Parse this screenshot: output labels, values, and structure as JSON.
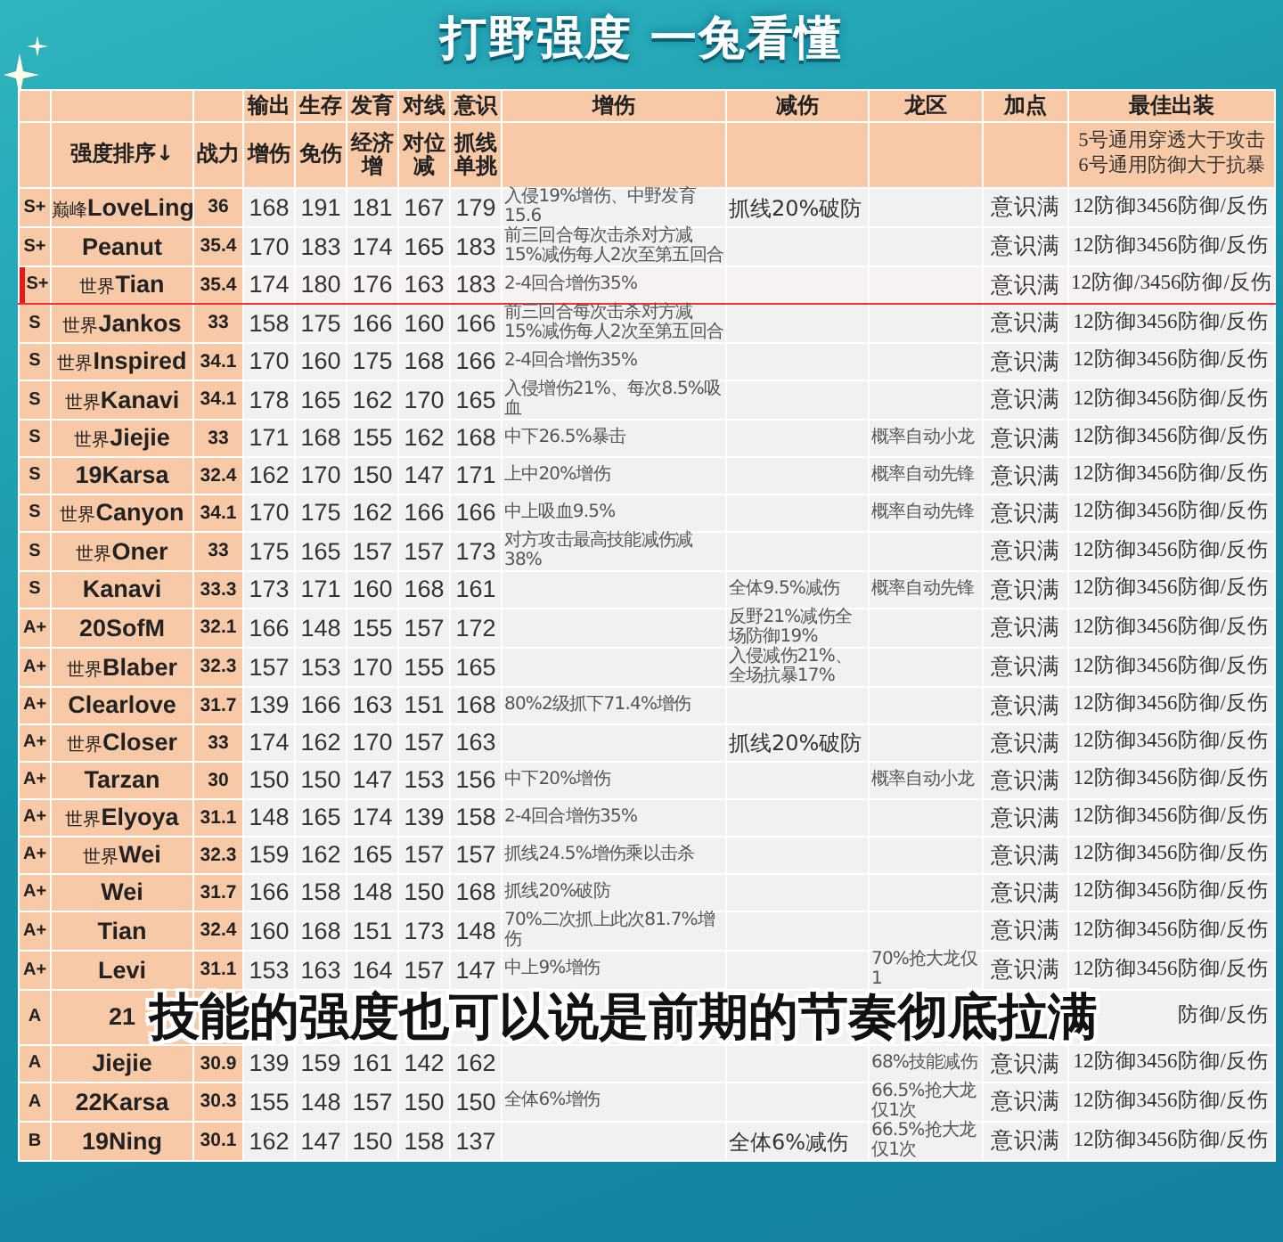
{
  "title": "打野强度 一兔看懂",
  "header_top": [
    "输出",
    "生存",
    "发育",
    "对线",
    "意识",
    "增伤",
    "减伤",
    "龙区",
    "加点",
    "最佳出装"
  ],
  "header_sub": {
    "rank": "强度排序↓",
    "power": "战力",
    "stats": [
      "增伤",
      "免伤",
      "经济增",
      "对位减",
      "抓线单挑"
    ],
    "build_note": [
      "5号通用穿透大于攻击",
      "6号通用防御大于抗暴"
    ]
  },
  "rows": [
    {
      "tier": "S+",
      "prefix": "巅峰",
      "name": "LoveLing",
      "power": "36",
      "stats": [
        "168",
        "191",
        "181",
        "167",
        "179"
      ],
      "damage": "入侵19%增伤、中野发育15.6",
      "reduction": "抓线20%破防",
      "reduction_large": true,
      "points": "意识满",
      "build": "12防御3456防御/反伤",
      "selected": false
    },
    {
      "tier": "S+",
      "name": "Peanut",
      "power": "35.4",
      "stats": [
        "170",
        "183",
        "174",
        "165",
        "183"
      ],
      "damage": "前三回合每次击杀对方减15%减伤每人2次至第五回合",
      "points": "意识满",
      "build": "12防御3456防御/反伤",
      "selected": false
    },
    {
      "tier": "S+",
      "prefix": "世界",
      "name": "Tian",
      "power": "35.4",
      "stats": [
        "174",
        "180",
        "176",
        "163",
        "183"
      ],
      "damage": "2-4回合增伤35%",
      "points": "意识满",
      "build": "12防御/3456防御/反伤",
      "selected": true
    },
    {
      "tier": "S",
      "prefix": "世界",
      "name": "Jankos",
      "power": "33",
      "stats": [
        "158",
        "175",
        "166",
        "160",
        "166"
      ],
      "damage": "前三回合每次击杀对方减15%减伤每人2次至第五回合",
      "points": "意识满",
      "build": "12防御3456防御/反伤",
      "selected": false
    },
    {
      "tier": "S",
      "prefix": "世界",
      "name": "Inspired",
      "power": "34.1",
      "stats": [
        "170",
        "160",
        "175",
        "168",
        "166"
      ],
      "damage": "2-4回合增伤35%",
      "points": "意识满",
      "build": "12防御3456防御/反伤",
      "selected": false
    },
    {
      "tier": "S",
      "prefix": "世界",
      "name": "Kanavi",
      "power": "34.1",
      "stats": [
        "178",
        "165",
        "162",
        "170",
        "165"
      ],
      "damage": "入侵增伤21%、每次8.5%吸血",
      "points": "意识满",
      "build": "12防御3456防御/反伤",
      "selected": false
    },
    {
      "tier": "S",
      "prefix": "世界",
      "name": "Jiejie",
      "power": "33",
      "stats": [
        "171",
        "168",
        "155",
        "162",
        "168"
      ],
      "damage": "中下26.5%暴击",
      "dragon": "概率自动小龙",
      "points": "意识满",
      "build": "12防御3456防御/反伤",
      "selected": false
    },
    {
      "tier": "S",
      "name": "19Karsa",
      "power": "32.4",
      "stats": [
        "162",
        "170",
        "150",
        "147",
        "171"
      ],
      "damage": "上中20%增伤",
      "dragon": "概率自动先锋",
      "points": "意识满",
      "build": "12防御3456防御/反伤",
      "selected": false
    },
    {
      "tier": "S",
      "prefix": "世界",
      "name": "Canyon",
      "power": "34.1",
      "stats": [
        "170",
        "175",
        "162",
        "166",
        "166"
      ],
      "damage": "中上吸血9.5%",
      "dragon": "概率自动先锋",
      "points": "意识满",
      "build": "12防御3456防御/反伤",
      "selected": false
    },
    {
      "tier": "S",
      "prefix": "世界",
      "name": "Oner",
      "power": "33",
      "stats": [
        "175",
        "165",
        "157",
        "157",
        "173"
      ],
      "damage": "对方攻击最高技能减伤减38%",
      "points": "意识满",
      "build": "12防御3456防御/反伤",
      "selected": false
    },
    {
      "tier": "S",
      "name": "Kanavi",
      "power": "33.3",
      "stats": [
        "173",
        "171",
        "160",
        "168",
        "161"
      ],
      "reduction": "全体9.5%减伤",
      "reduction_large": false,
      "dragon": "概率自动先锋",
      "points": "意识满",
      "build": "12防御3456防御/反伤",
      "selected": false
    },
    {
      "tier": "A+",
      "name": "20SofM",
      "power": "32.1",
      "stats": [
        "166",
        "148",
        "155",
        "157",
        "172"
      ],
      "reduction": "反野21%减伤全场防御19%",
      "reduction_large": false,
      "points": "意识满",
      "build": "12防御3456防御/反伤",
      "selected": false
    },
    {
      "tier": "A+",
      "prefix": "世界",
      "name": "Blaber",
      "power": "32.3",
      "stats": [
        "157",
        "153",
        "170",
        "155",
        "165"
      ],
      "reduction": "入侵减伤21%、全场抗暴17%",
      "reduction_large": false,
      "points": "意识满",
      "build": "12防御3456防御/反伤",
      "selected": false
    },
    {
      "tier": "A+",
      "name": "Clearlove",
      "power": "31.7",
      "stats": [
        "139",
        "166",
        "163",
        "151",
        "168"
      ],
      "damage": "80%2级抓下71.4%增伤",
      "points": "意识满",
      "build": "12防御3456防御/反伤",
      "selected": false
    },
    {
      "tier": "A+",
      "prefix": "世界",
      "name": "Closer",
      "power": "33",
      "stats": [
        "174",
        "162",
        "170",
        "157",
        "163"
      ],
      "reduction": "抓线20%破防",
      "reduction_large": true,
      "points": "意识满",
      "build": "12防御3456防御/反伤",
      "selected": false
    },
    {
      "tier": "A+",
      "name": "Tarzan",
      "power": "30",
      "stats": [
        "150",
        "150",
        "147",
        "153",
        "156"
      ],
      "damage": "中下20%增伤",
      "dragon": "概率自动小龙",
      "points": "意识满",
      "build": "12防御3456防御/反伤",
      "selected": false
    },
    {
      "tier": "A+",
      "prefix": "世界",
      "name": "Elyoya",
      "power": "31.1",
      "stats": [
        "148",
        "165",
        "174",
        "139",
        "158"
      ],
      "damage": "2-4回合增伤35%",
      "points": "意识满",
      "build": "12防御3456防御/反伤",
      "selected": false
    },
    {
      "tier": "A+",
      "prefix": "世界",
      "name": "Wei",
      "power": "32.3",
      "stats": [
        "159",
        "162",
        "165",
        "157",
        "157"
      ],
      "damage": "抓线24.5%增伤乘以击杀",
      "points": "意识满",
      "build": "12防御3456防御/反伤",
      "selected": false
    },
    {
      "tier": "A+",
      "name": "Wei",
      "power": "31.7",
      "stats": [
        "166",
        "158",
        "148",
        "150",
        "168"
      ],
      "damage": "抓线20%破防",
      "points": "意识满",
      "build": "12防御3456防御/反伤",
      "selected": false
    },
    {
      "tier": "A+",
      "name": "Tian",
      "power": "32.4",
      "stats": [
        "160",
        "168",
        "151",
        "173",
        "148"
      ],
      "damage": "70%二次抓上此次81.7%增伤",
      "points": "意识满",
      "build": "12防御3456防御/反伤",
      "selected": false
    },
    {
      "tier": "A+",
      "name": "Levi",
      "power": "31.1",
      "stats": [
        "153",
        "163",
        "164",
        "157",
        "147"
      ],
      "damage": "中上9%增伤",
      "dragon": "70%抢大龙仅1",
      "points": "意识满",
      "build": "12防御3456防御/反伤",
      "selected": false
    },
    {
      "tier": "A",
      "name": "21",
      "build": "防御/反伤",
      "selected": false
    },
    {
      "tier": "A",
      "name": "Jiejie",
      "power": "30.9",
      "stats": [
        "139",
        "159",
        "161",
        "142",
        "162"
      ],
      "dragon": "68%技能减伤",
      "points": "意识满",
      "build": "12防御3456防御/反伤",
      "selected": false
    },
    {
      "tier": "A",
      "name": "22Karsa",
      "power": "30.3",
      "stats": [
        "155",
        "148",
        "157",
        "150",
        "150"
      ],
      "damage": "全体6%增伤",
      "dragon": "66.5%抢大龙仅1次",
      "points": "意识满",
      "build": "12防御3456防御/反伤",
      "selected": false
    },
    {
      "tier": "B",
      "name": "19Ning",
      "power": "30.1",
      "stats": [
        "162",
        "147",
        "150",
        "158",
        "137"
      ],
      "reduction": "全体6%减伤",
      "reduction_large": true,
      "dragon": "66.5%抢大龙仅1次",
      "points": "意识满",
      "build": "12防御3456防御/反伤",
      "selected": false
    }
  ],
  "subtitle": "技能的强度也可以说是前期的节奏彻底拉满"
}
